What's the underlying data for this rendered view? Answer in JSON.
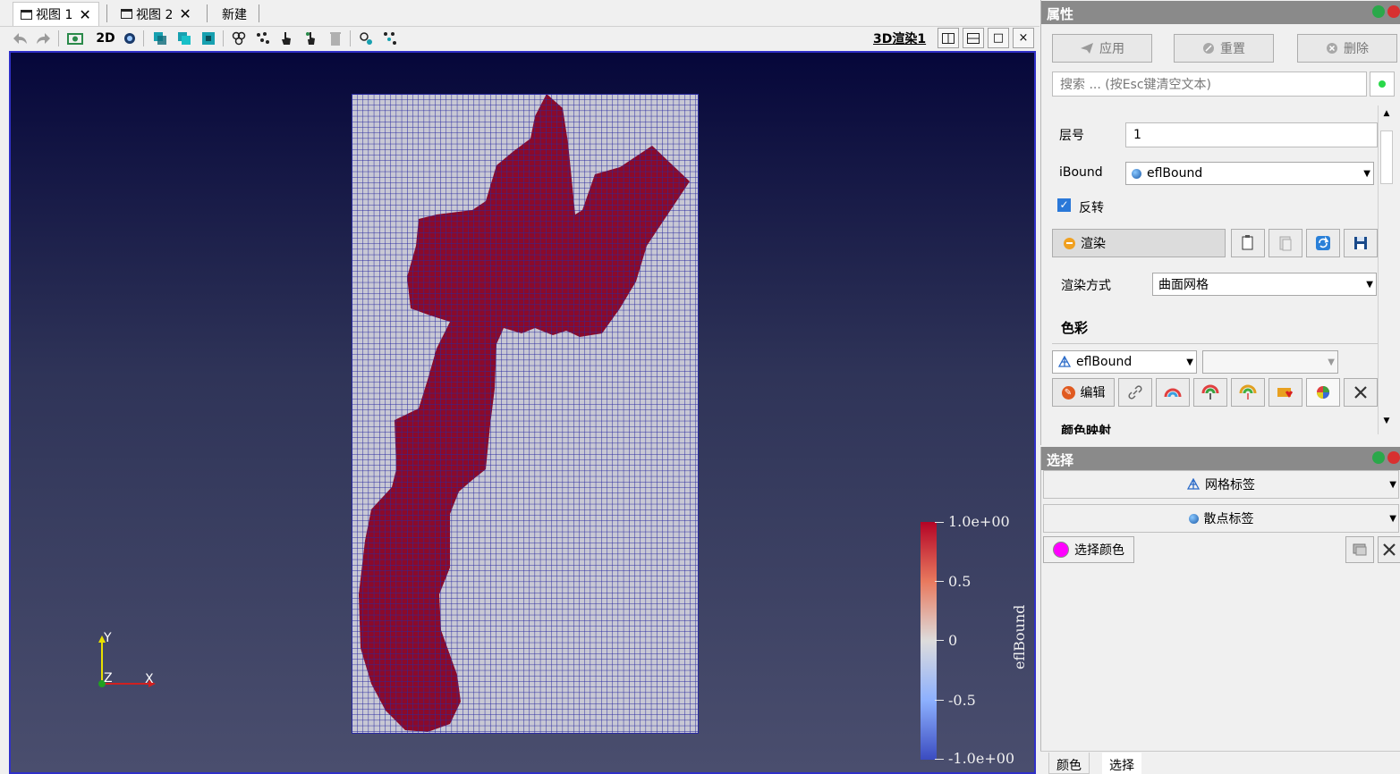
{
  "tabs": [
    {
      "label": "视图 1",
      "active": true
    },
    {
      "label": "视图 2",
      "active": false
    },
    {
      "label": "新建",
      "active": false
    }
  ],
  "toolbar": {
    "mode_2d": "2D",
    "view_title": "3D渲染1",
    "maximize": "□",
    "close": "×"
  },
  "viewport": {
    "colorbar": {
      "title": "eflBound",
      "ticks": [
        "1.0e+00",
        "0.5",
        "0",
        "-0.5",
        "-1.0e+00"
      ],
      "colors": {
        "max": "#b40426",
        "mid": "#dddcdc",
        "min": "#3b4cc0"
      }
    },
    "axes": {
      "x": "X",
      "y": "Y",
      "z": "Z"
    },
    "mesh_colors": {
      "active": "#8b0a2a",
      "inactive": "#c8c8d4",
      "grid": "#2a2aa0"
    }
  },
  "properties": {
    "title": "属性",
    "apply": "应用",
    "reset": "重置",
    "delete": "删除",
    "search_placeholder": "搜索 ... (按Esc键清空文本)",
    "layer_label": "层号",
    "layer_value": "1",
    "ibound_label": "iBound",
    "ibound_value": "eflBound",
    "invert_label": "反转",
    "invert_checked": true,
    "render_section": "渲染",
    "render_mode_label": "渲染方式",
    "render_mode_value": "曲面网格",
    "color_section": "色彩",
    "color_array": "eflBound",
    "color_component": "",
    "edit_label": "编辑",
    "colormap_label": "颜色映射"
  },
  "selection": {
    "title": "选择",
    "mesh_labels": "网格标签",
    "point_labels": "散点标签",
    "select_color": "选择颜色",
    "select_color_value": "#ff00ff"
  },
  "bottom_tabs": [
    "颜色",
    "选择"
  ]
}
